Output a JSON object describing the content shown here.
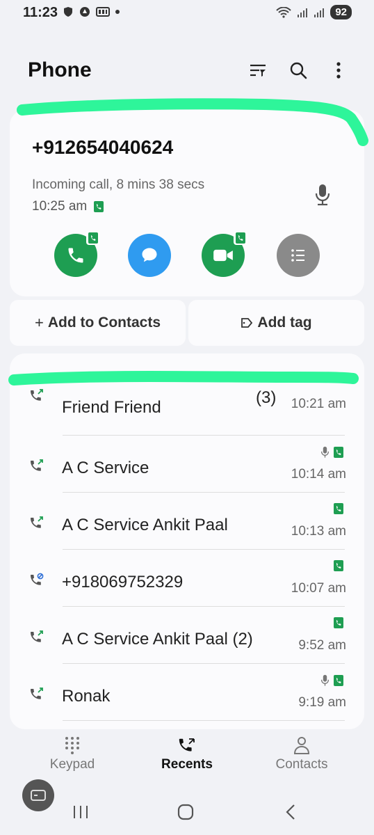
{
  "status_bar": {
    "time": "11:23",
    "battery": "92"
  },
  "header": {
    "title": "Phone"
  },
  "call_detail": {
    "number": "+912654040624",
    "description": "Incoming call, 8 mins 38 secs",
    "time": "10:25 am"
  },
  "actions": {
    "add_contact": "Add to Contacts",
    "add_tag": "Add tag"
  },
  "recents": {
    "partial_item": {
      "name": "Friend Friend",
      "count": "(3)",
      "time": "10:21 am"
    },
    "items": [
      {
        "name": "A C Service",
        "time": "10:14 am",
        "type": "outgoing",
        "mic": true
      },
      {
        "name": "A C Service Ankit Paal",
        "time": "10:13 am",
        "type": "outgoing",
        "mic": false
      },
      {
        "name": "+918069752329",
        "time": "10:07 am",
        "type": "blocked",
        "mic": false
      },
      {
        "name": "A C Service Ankit Paal (2)",
        "time": "9:52 am",
        "type": "outgoing",
        "mic": false
      },
      {
        "name": "Ronak",
        "time": "9:19 am",
        "type": "outgoing",
        "mic": true
      }
    ]
  },
  "bottom_nav": {
    "keypad": "Keypad",
    "recents": "Recents",
    "contacts": "Contacts"
  },
  "colors": {
    "green": "#1e9e52",
    "blue": "#2f9bf0",
    "gray": "#8a8a8a",
    "highlighter": "#2ef59a"
  }
}
